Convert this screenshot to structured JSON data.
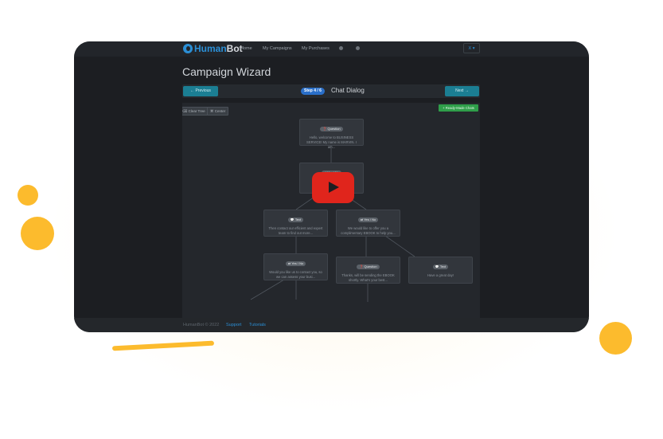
{
  "app": {
    "name_primary": "Human",
    "name_secondary": "Bot"
  },
  "nav": {
    "items": [
      {
        "label": "Home"
      },
      {
        "label": "My Campaigns"
      },
      {
        "label": "My Purchases"
      }
    ],
    "language": "X ▾"
  },
  "page": {
    "title": "Campaign Wizard"
  },
  "wizard": {
    "prev_label": "← Previous",
    "next_label": "Next →",
    "step_badge": "Step 4 / 6",
    "step_title": "Chat Dialog"
  },
  "toolbar": {
    "clear_label": "⌫ Clear Tree",
    "center_label": "⌘ Center",
    "ready_label": "+ Ready-Made Chats"
  },
  "flow": {
    "nodes": [
      {
        "type": "❓ Question",
        "text": "Hello, welcome to BUSINESS SERVICE! My name is MARVIN. I am..."
      },
      {
        "type": "⇄ Yes / No",
        "text": ""
      },
      {
        "type": "💬 Text",
        "text": "Then contact our efficient and expert team to find out more..."
      },
      {
        "type": "⇄ Yes / No",
        "text": "We would like to offer you a complimentary EBOOK to help you..."
      },
      {
        "type": "⇄ Yes / No",
        "text": "Would you like us to contact you, so we can assess your busi..."
      },
      {
        "type": "❓ Question",
        "text": "Thanks, will be sending the EBOOK shortly. What's your best..."
      },
      {
        "type": "💬 Text",
        "text": "Have a great day!"
      },
      {
        "type": "❓ Question",
        "text": ""
      },
      {
        "type": "⇄ Yes / No",
        "text": ""
      },
      {
        "type": "💬 Text",
        "text": ""
      }
    ]
  },
  "footer": {
    "copyright": "HumanBot © 2022",
    "support": "Support",
    "tutorials": "Tutorials"
  },
  "colors": {
    "accent": "#2b8fd6",
    "brand_yellow": "#fcbb2d",
    "play_red": "#e0251c",
    "success": "#2f9e4a"
  }
}
